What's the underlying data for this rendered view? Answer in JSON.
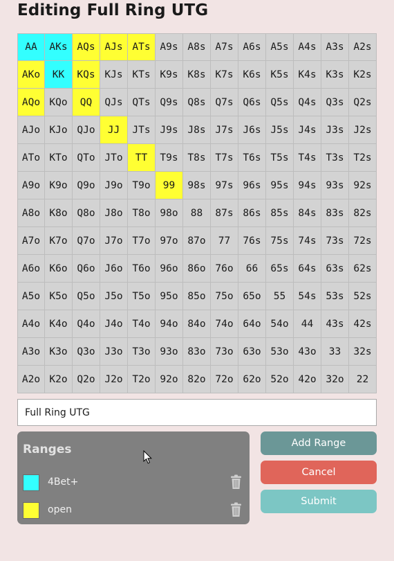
{
  "title": "Editing Full Ring UTG",
  "range_name_input": {
    "value": "Full Ring UTG"
  },
  "colors": {
    "cyan": "#33ffff",
    "yellow": "#ffff33",
    "unassigned": "#d3d3d3"
  },
  "grid": [
    [
      {
        "label": "AA",
        "color": "cyan"
      },
      {
        "label": "AKs",
        "color": "cyan"
      },
      {
        "label": "AQs",
        "color": "yellow"
      },
      {
        "label": "AJs",
        "color": "yellow"
      },
      {
        "label": "ATs",
        "color": "yellow"
      },
      {
        "label": "A9s",
        "color": "unassigned"
      },
      {
        "label": "A8s",
        "color": "unassigned"
      },
      {
        "label": "A7s",
        "color": "unassigned"
      },
      {
        "label": "A6s",
        "color": "unassigned"
      },
      {
        "label": "A5s",
        "color": "unassigned"
      },
      {
        "label": "A4s",
        "color": "unassigned"
      },
      {
        "label": "A3s",
        "color": "unassigned"
      },
      {
        "label": "A2s",
        "color": "unassigned"
      }
    ],
    [
      {
        "label": "AKo",
        "color": "yellow"
      },
      {
        "label": "KK",
        "color": "cyan"
      },
      {
        "label": "KQs",
        "color": "yellow"
      },
      {
        "label": "KJs",
        "color": "unassigned"
      },
      {
        "label": "KTs",
        "color": "unassigned"
      },
      {
        "label": "K9s",
        "color": "unassigned"
      },
      {
        "label": "K8s",
        "color": "unassigned"
      },
      {
        "label": "K7s",
        "color": "unassigned"
      },
      {
        "label": "K6s",
        "color": "unassigned"
      },
      {
        "label": "K5s",
        "color": "unassigned"
      },
      {
        "label": "K4s",
        "color": "unassigned"
      },
      {
        "label": "K3s",
        "color": "unassigned"
      },
      {
        "label": "K2s",
        "color": "unassigned"
      }
    ],
    [
      {
        "label": "AQo",
        "color": "yellow"
      },
      {
        "label": "KQo",
        "color": "unassigned"
      },
      {
        "label": "QQ",
        "color": "yellow"
      },
      {
        "label": "QJs",
        "color": "unassigned"
      },
      {
        "label": "QTs",
        "color": "unassigned"
      },
      {
        "label": "Q9s",
        "color": "unassigned"
      },
      {
        "label": "Q8s",
        "color": "unassigned"
      },
      {
        "label": "Q7s",
        "color": "unassigned"
      },
      {
        "label": "Q6s",
        "color": "unassigned"
      },
      {
        "label": "Q5s",
        "color": "unassigned"
      },
      {
        "label": "Q4s",
        "color": "unassigned"
      },
      {
        "label": "Q3s",
        "color": "unassigned"
      },
      {
        "label": "Q2s",
        "color": "unassigned"
      }
    ],
    [
      {
        "label": "AJo",
        "color": "unassigned"
      },
      {
        "label": "KJo",
        "color": "unassigned"
      },
      {
        "label": "QJo",
        "color": "unassigned"
      },
      {
        "label": "JJ",
        "color": "yellow"
      },
      {
        "label": "JTs",
        "color": "unassigned"
      },
      {
        "label": "J9s",
        "color": "unassigned"
      },
      {
        "label": "J8s",
        "color": "unassigned"
      },
      {
        "label": "J7s",
        "color": "unassigned"
      },
      {
        "label": "J6s",
        "color": "unassigned"
      },
      {
        "label": "J5s",
        "color": "unassigned"
      },
      {
        "label": "J4s",
        "color": "unassigned"
      },
      {
        "label": "J3s",
        "color": "unassigned"
      },
      {
        "label": "J2s",
        "color": "unassigned"
      }
    ],
    [
      {
        "label": "ATo",
        "color": "unassigned"
      },
      {
        "label": "KTo",
        "color": "unassigned"
      },
      {
        "label": "QTo",
        "color": "unassigned"
      },
      {
        "label": "JTo",
        "color": "unassigned"
      },
      {
        "label": "TT",
        "color": "yellow"
      },
      {
        "label": "T9s",
        "color": "unassigned"
      },
      {
        "label": "T8s",
        "color": "unassigned"
      },
      {
        "label": "T7s",
        "color": "unassigned"
      },
      {
        "label": "T6s",
        "color": "unassigned"
      },
      {
        "label": "T5s",
        "color": "unassigned"
      },
      {
        "label": "T4s",
        "color": "unassigned"
      },
      {
        "label": "T3s",
        "color": "unassigned"
      },
      {
        "label": "T2s",
        "color": "unassigned"
      }
    ],
    [
      {
        "label": "A9o",
        "color": "unassigned"
      },
      {
        "label": "K9o",
        "color": "unassigned"
      },
      {
        "label": "Q9o",
        "color": "unassigned"
      },
      {
        "label": "J9o",
        "color": "unassigned"
      },
      {
        "label": "T9o",
        "color": "unassigned"
      },
      {
        "label": "99",
        "color": "yellow"
      },
      {
        "label": "98s",
        "color": "unassigned"
      },
      {
        "label": "97s",
        "color": "unassigned"
      },
      {
        "label": "96s",
        "color": "unassigned"
      },
      {
        "label": "95s",
        "color": "unassigned"
      },
      {
        "label": "94s",
        "color": "unassigned"
      },
      {
        "label": "93s",
        "color": "unassigned"
      },
      {
        "label": "92s",
        "color": "unassigned"
      }
    ],
    [
      {
        "label": "A8o",
        "color": "unassigned"
      },
      {
        "label": "K8o",
        "color": "unassigned"
      },
      {
        "label": "Q8o",
        "color": "unassigned"
      },
      {
        "label": "J8o",
        "color": "unassigned"
      },
      {
        "label": "T8o",
        "color": "unassigned"
      },
      {
        "label": "98o",
        "color": "unassigned"
      },
      {
        "label": "88",
        "color": "unassigned"
      },
      {
        "label": "87s",
        "color": "unassigned"
      },
      {
        "label": "86s",
        "color": "unassigned"
      },
      {
        "label": "85s",
        "color": "unassigned"
      },
      {
        "label": "84s",
        "color": "unassigned"
      },
      {
        "label": "83s",
        "color": "unassigned"
      },
      {
        "label": "82s",
        "color": "unassigned"
      }
    ],
    [
      {
        "label": "A7o",
        "color": "unassigned"
      },
      {
        "label": "K7o",
        "color": "unassigned"
      },
      {
        "label": "Q7o",
        "color": "unassigned"
      },
      {
        "label": "J7o",
        "color": "unassigned"
      },
      {
        "label": "T7o",
        "color": "unassigned"
      },
      {
        "label": "97o",
        "color": "unassigned"
      },
      {
        "label": "87o",
        "color": "unassigned"
      },
      {
        "label": "77",
        "color": "unassigned"
      },
      {
        "label": "76s",
        "color": "unassigned"
      },
      {
        "label": "75s",
        "color": "unassigned"
      },
      {
        "label": "74s",
        "color": "unassigned"
      },
      {
        "label": "73s",
        "color": "unassigned"
      },
      {
        "label": "72s",
        "color": "unassigned"
      }
    ],
    [
      {
        "label": "A6o",
        "color": "unassigned"
      },
      {
        "label": "K6o",
        "color": "unassigned"
      },
      {
        "label": "Q6o",
        "color": "unassigned"
      },
      {
        "label": "J6o",
        "color": "unassigned"
      },
      {
        "label": "T6o",
        "color": "unassigned"
      },
      {
        "label": "96o",
        "color": "unassigned"
      },
      {
        "label": "86o",
        "color": "unassigned"
      },
      {
        "label": "76o",
        "color": "unassigned"
      },
      {
        "label": "66",
        "color": "unassigned"
      },
      {
        "label": "65s",
        "color": "unassigned"
      },
      {
        "label": "64s",
        "color": "unassigned"
      },
      {
        "label": "63s",
        "color": "unassigned"
      },
      {
        "label": "62s",
        "color": "unassigned"
      }
    ],
    [
      {
        "label": "A5o",
        "color": "unassigned"
      },
      {
        "label": "K5o",
        "color": "unassigned"
      },
      {
        "label": "Q5o",
        "color": "unassigned"
      },
      {
        "label": "J5o",
        "color": "unassigned"
      },
      {
        "label": "T5o",
        "color": "unassigned"
      },
      {
        "label": "95o",
        "color": "unassigned"
      },
      {
        "label": "85o",
        "color": "unassigned"
      },
      {
        "label": "75o",
        "color": "unassigned"
      },
      {
        "label": "65o",
        "color": "unassigned"
      },
      {
        "label": "55",
        "color": "unassigned"
      },
      {
        "label": "54s",
        "color": "unassigned"
      },
      {
        "label": "53s",
        "color": "unassigned"
      },
      {
        "label": "52s",
        "color": "unassigned"
      }
    ],
    [
      {
        "label": "A4o",
        "color": "unassigned"
      },
      {
        "label": "K4o",
        "color": "unassigned"
      },
      {
        "label": "Q4o",
        "color": "unassigned"
      },
      {
        "label": "J4o",
        "color": "unassigned"
      },
      {
        "label": "T4o",
        "color": "unassigned"
      },
      {
        "label": "94o",
        "color": "unassigned"
      },
      {
        "label": "84o",
        "color": "unassigned"
      },
      {
        "label": "74o",
        "color": "unassigned"
      },
      {
        "label": "64o",
        "color": "unassigned"
      },
      {
        "label": "54o",
        "color": "unassigned"
      },
      {
        "label": "44",
        "color": "unassigned"
      },
      {
        "label": "43s",
        "color": "unassigned"
      },
      {
        "label": "42s",
        "color": "unassigned"
      }
    ],
    [
      {
        "label": "A3o",
        "color": "unassigned"
      },
      {
        "label": "K3o",
        "color": "unassigned"
      },
      {
        "label": "Q3o",
        "color": "unassigned"
      },
      {
        "label": "J3o",
        "color": "unassigned"
      },
      {
        "label": "T3o",
        "color": "unassigned"
      },
      {
        "label": "93o",
        "color": "unassigned"
      },
      {
        "label": "83o",
        "color": "unassigned"
      },
      {
        "label": "73o",
        "color": "unassigned"
      },
      {
        "label": "63o",
        "color": "unassigned"
      },
      {
        "label": "53o",
        "color": "unassigned"
      },
      {
        "label": "43o",
        "color": "unassigned"
      },
      {
        "label": "33",
        "color": "unassigned"
      },
      {
        "label": "32s",
        "color": "unassigned"
      }
    ],
    [
      {
        "label": "A2o",
        "color": "unassigned"
      },
      {
        "label": "K2o",
        "color": "unassigned"
      },
      {
        "label": "Q2o",
        "color": "unassigned"
      },
      {
        "label": "J2o",
        "color": "unassigned"
      },
      {
        "label": "T2o",
        "color": "unassigned"
      },
      {
        "label": "92o",
        "color": "unassigned"
      },
      {
        "label": "82o",
        "color": "unassigned"
      },
      {
        "label": "72o",
        "color": "unassigned"
      },
      {
        "label": "62o",
        "color": "unassigned"
      },
      {
        "label": "52o",
        "color": "unassigned"
      },
      {
        "label": "42o",
        "color": "unassigned"
      },
      {
        "label": "32o",
        "color": "unassigned"
      },
      {
        "label": "22",
        "color": "unassigned"
      }
    ]
  ],
  "ranges_panel": {
    "title": "Ranges",
    "items": [
      {
        "name": "4Bet+",
        "color": "#33ffff",
        "delete_icon": "trash-icon"
      },
      {
        "name": "open",
        "color": "#ffff33",
        "delete_icon": "trash-icon"
      }
    ]
  },
  "buttons": {
    "add_range": {
      "label": "Add Range",
      "color": "#6b9797"
    },
    "cancel": {
      "label": "Cancel",
      "color": "#e0655a"
    },
    "submit": {
      "label": "Submit",
      "color": "#7cc6c4"
    }
  }
}
